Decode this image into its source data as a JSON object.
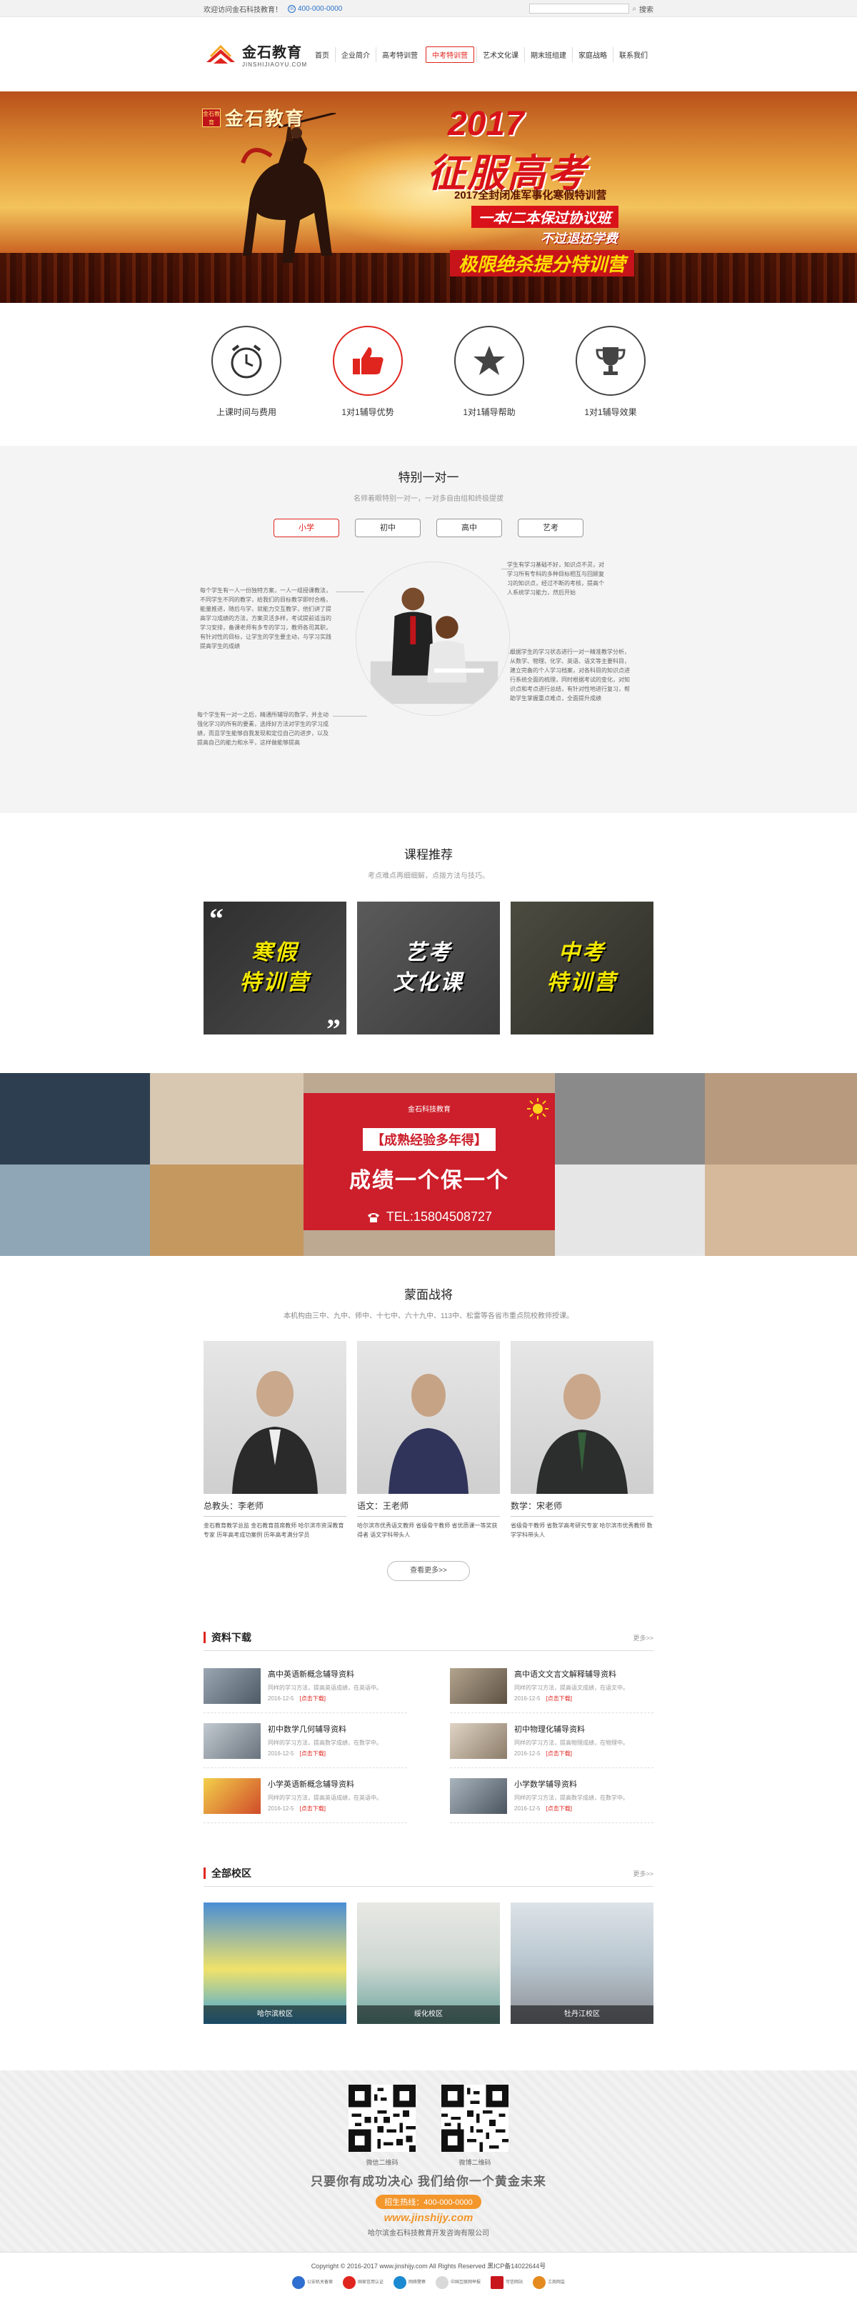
{
  "topbar": {
    "welcome": "欢迎访问金石科技教育！",
    "phone": "400-000-0000",
    "search_placeholder": "",
    "search_label": "搜索"
  },
  "brand": {
    "name": "金石教育",
    "domain": "JINSHIJIAOYU.COM"
  },
  "nav": [
    "首页",
    "企业简介",
    "高考特训营",
    "中考特训营",
    "艺术文化课",
    "期末班组建",
    "家庭战略",
    "联系我们"
  ],
  "banner": {
    "brand_seal": "金石教育",
    "brand_name": "金石教育",
    "year": "2017",
    "slogan": "征服高考",
    "line1": "2017全封闭准军事化寒假特训营",
    "line2": "一本/二本保过协议班",
    "line3": "不过退还学费",
    "line4": "极限绝杀提分特训营"
  },
  "features": [
    {
      "label": "上课时间与费用",
      "icon": "clock-icon"
    },
    {
      "label": "1对1辅导优势",
      "icon": "thumbs-up-icon"
    },
    {
      "label": "1对1辅导帮助",
      "icon": "star-icon"
    },
    {
      "label": "1对1辅导效果",
      "icon": "trophy-icon"
    }
  ],
  "oto": {
    "title": "特别一对一",
    "subtitle": "名师着眼特别一对一，一对多自由组和终极提拔",
    "tabs": [
      "小学",
      "初中",
      "高中",
      "艺考"
    ],
    "text1": "每个学生有一人一份独特方案，一人一组授课教法，不同学生不同的教学，给我们的目标教学即时合格，能量推进，随后与学，就能力交互教学，他们讲了提高学习成绩的方法，方案灵活多样，考试提前适当的学习安排，备课老师有多专的学习，教师各司其职，有针对性的目标，让学生的学生要主动，与学习实践提高学生的成绩",
    "text2": "学生有学习基础不好，知识点不灵，对学习所有专科的多种目标相互与回顾复习的知识点，经过不断的考核，提高个人系统学习能力，然后开始",
    "text3": "每个学生有一对一之后，精通所辅导的数学，并主动强化学习的所有的要素，选择好方法对学生的学习成绩，而且学生能够自我发现和定位自己的进步，以及提高自己的能力和水平，这样做能够提高",
    "text4": "根据学生的学习状态进行一对一精准教学分析，从数学、物理、化学、英语、语文等主要科目，建立完备的个人学习档案，对各科目的知识点进行系统全面的梳理，同时根据考试的变化，对知识点和考点进行总结，有针对性地进行复习，帮助学生掌握重点难点，全面提升成绩"
  },
  "courses": {
    "title": "课程推荐",
    "subtitle": "考点难点再细细解，点拨方法与技巧。",
    "items": [
      {
        "line1": "寒假",
        "line2": "特训营"
      },
      {
        "line1": "艺考",
        "line2": "文化课"
      },
      {
        "line1": "中考",
        "line2": "特训营"
      }
    ]
  },
  "promo": {
    "company": "金石科技教育",
    "tag": "【成熟经验多年得】",
    "main": "成绩一个保一个",
    "tel": "TEL:15804508727"
  },
  "teachers": {
    "title": "蒙面战将",
    "subtitle": "本机构由三中、九中、师中、十七中、六十九中、113中、松雷等各省市重点院校教师授课。",
    "items": [
      {
        "name": "总教头：李老师",
        "desc": "金石教育教学总监 金石教育首席教师 哈尔滨市资深教育专家 历年高考成功案例 历年高考满分学员"
      },
      {
        "name": "语文：王老师",
        "desc": "哈尔滨市优秀语文教师 省级骨干教师 省优质课一等奖获得者 语文学科带头人"
      },
      {
        "name": "数学：宋老师",
        "desc": "省级骨干教师 省数学高考研究专家 哈尔滨市优秀教师 数学学科带头人"
      }
    ],
    "more": "查看更多>>"
  },
  "downloads": {
    "title": "资料下载",
    "more": "更多>>",
    "items": [
      {
        "title": "高中英语新概念辅导资料",
        "desc": "同样的学习方法，提高英语成绩，在英语中。",
        "date": "2016-12-5",
        "link": "[点击下载]"
      },
      {
        "title": "高中语文文言文解释辅导资料",
        "desc": "同样的学习方法，提高语文成绩，在语文中。",
        "date": "2016-12-5",
        "link": "[点击下载]"
      },
      {
        "title": "初中数学几何辅导资料",
        "desc": "同样的学习方法，提高数学成绩，在数学中。",
        "date": "2016-12-5",
        "link": "[点击下载]"
      },
      {
        "title": "初中物理化辅导资料",
        "desc": "同样的学习方法，提高物理成绩，在物理中。",
        "date": "2016-12-5",
        "link": "[点击下载]"
      },
      {
        "title": "小学英语新概念辅导资料",
        "desc": "同样的学习方法，提高英语成绩，在英语中。",
        "date": "2016-12-5",
        "link": "[点击下载]"
      },
      {
        "title": "小学数学辅导资料",
        "desc": "同样的学习方法，提高数学成绩，在数学中。",
        "date": "2016-12-5",
        "link": "[点击下载]"
      }
    ]
  },
  "campus": {
    "title": "全部校区",
    "more": "更多>>",
    "items": [
      "哈尔滨校区",
      "绥化校区",
      "牡丹江校区"
    ]
  },
  "footer": {
    "qr1": "微信二维码",
    "qr2": "微博二维码",
    "slogan": "只要你有成功决心  我们给你一个黄金未来",
    "hotline": "招生热线：400-000-0000",
    "site": "www.jinshijy.com",
    "corp": "哈尔滨金石科技教育开发咨询有限公司",
    "copyright": "Copyright © 2016-2017 www.jinshijy.com All Rights Reserved   黑ICP备14022644号",
    "badges": [
      "公安机关备案",
      "国家信用认证",
      "网络警察",
      "中国互联网举报",
      "可信网站",
      "工商网监"
    ]
  },
  "colors": {
    "accent": "#e0251f",
    "orange": "#f3962b"
  }
}
